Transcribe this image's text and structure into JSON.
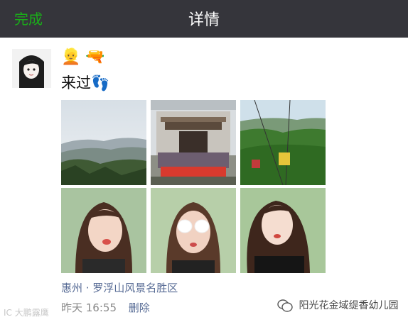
{
  "nav": {
    "done_label": "完成",
    "title": "详情"
  },
  "post": {
    "header_emoji": "👱 🔫",
    "text": "来过👣",
    "location": "惠州 · 罗浮山风景名胜区",
    "time": "昨天 16:55",
    "delete_label": "删除"
  },
  "watermarks": {
    "left": "IC 大鹏露鹰",
    "right": "阳光花金域缇香幼儿园"
  },
  "colors": {
    "nav_bg": "#35353b",
    "accent_green": "#1aad19",
    "link_blue": "#576b95",
    "time_gray": "#8a8a8a"
  }
}
